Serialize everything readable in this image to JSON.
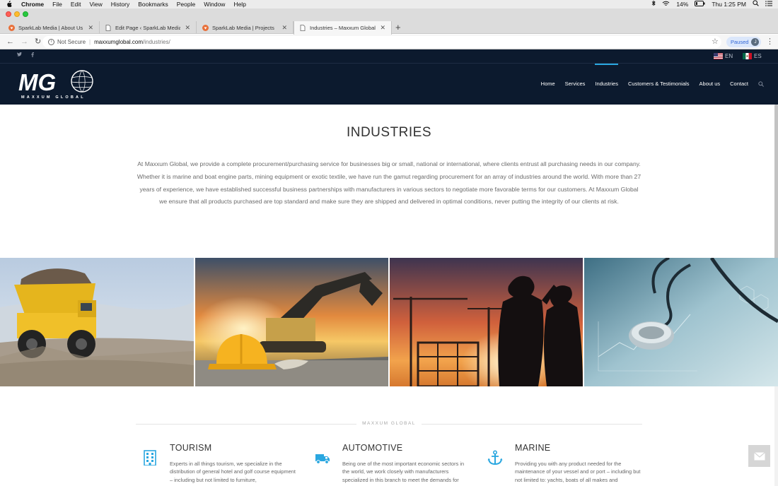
{
  "menubar": {
    "app_name": "Chrome",
    "items": [
      "File",
      "Edit",
      "View",
      "History",
      "Bookmarks",
      "People",
      "Window",
      "Help"
    ],
    "battery": "14%",
    "clock": "Thu 1:25 PM"
  },
  "tabs": [
    {
      "label": "SparkLab Media | About Us",
      "favicon": "sparklab-icon",
      "active": false
    },
    {
      "label": "Edit Page ‹ SparkLab Media —",
      "favicon": "page-icon",
      "active": false
    },
    {
      "label": "SparkLab Media | Projects",
      "favicon": "sparklab-icon",
      "active": false
    },
    {
      "label": "Industries – Maxxum Global",
      "favicon": "page-icon",
      "active": true
    }
  ],
  "toolbar": {
    "security_label": "Not Secure",
    "url_host": "maxxumglobal.com",
    "url_path": "/industries/",
    "paused_label": "Paused",
    "avatar_letter": "J"
  },
  "site": {
    "social": [
      "twitter-icon",
      "facebook-icon"
    ],
    "languages": [
      {
        "code": "EN",
        "flag": "us-flag-icon"
      },
      {
        "code": "ES",
        "flag": "mexico-flag-icon"
      }
    ],
    "logo_text": "MG",
    "logo_subtext": "MAXXUM GLOBAL",
    "nav": [
      {
        "label": "Home",
        "active": false
      },
      {
        "label": "Services",
        "active": false
      },
      {
        "label": "Industries",
        "active": true
      },
      {
        "label": "Customers & Testimonials",
        "active": false
      },
      {
        "label": "About us",
        "active": false
      },
      {
        "label": "Contact",
        "active": false
      }
    ],
    "accent_color": "#2aa7e0",
    "header_color": "#0c1a2e"
  },
  "main": {
    "title": "INDUSTRIES",
    "intro": "At Maxxum Global, we provide a complete procurement/purchasing service for businesses big or small, national or international, where clients entrust all purchasing needs in our company. Whether it is marine and boat engine parts, mining equipment or exotic textile, we have run the gamut regarding procurement for an array of industries around the world. With more than 27 years of experience, we have established successful business partnerships with manufacturers in various sectors to negotiate more favorable terms for our customers. At Maxxum Global we ensure that all products purchased are top standard and make sure they are shipped and delivered in optimal conditions, never putting the integrity of our clients at risk.",
    "images": [
      "mining-truck-image",
      "construction-excavator-image",
      "construction-workers-silhouette-image",
      "stethoscope-medical-image"
    ],
    "divider_label": "MAXXUM GLOBAL",
    "features": [
      {
        "icon": "building-icon",
        "title": "TOURISM",
        "text": "Experts in all things tourism, we specialize in the distribution of general hotel and golf course equipment – including but not limited to furniture,"
      },
      {
        "icon": "truck-icon",
        "title": "AUTOMOTIVE",
        "text": "Being one of the most important economic sectors in the world, we work closely with manufacturers specialized in this branch to meet the demands for"
      },
      {
        "icon": "anchor-icon",
        "title": "MARINE",
        "text": "Providing you with any product needed for the maintenance of your vessel and or port – including but not limited to: yachts, boats of all makes and"
      }
    ]
  }
}
